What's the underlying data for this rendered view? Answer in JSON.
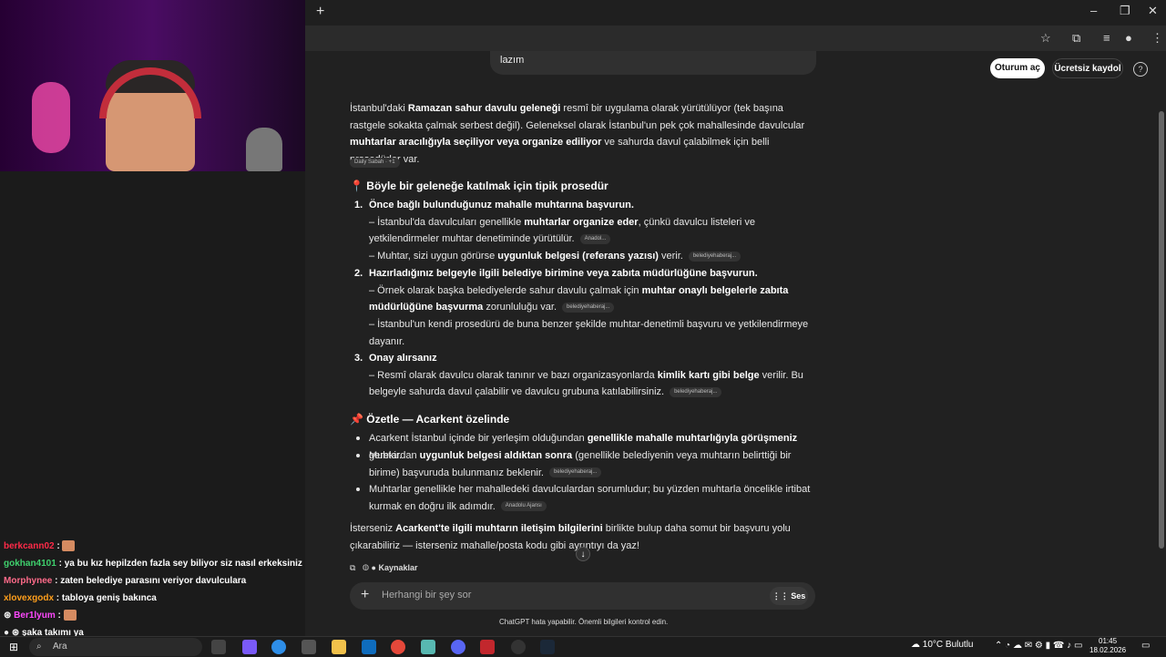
{
  "browser": {
    "new_tab": "+",
    "window_controls": [
      "–",
      "❐",
      "✕"
    ],
    "toolbar_icons": [
      "star-icon",
      "extension-icon",
      "media-icon",
      "profile-icon",
      "menu-icon"
    ]
  },
  "header": {
    "bubble_text": "lazım",
    "login": "Oturum aç",
    "signup": "Ücretsiz kaydol",
    "help": "?"
  },
  "intro": {
    "p1": "İstanbul'daki ",
    "b1": "Ramazan sahur davulu geleneği",
    "p2": " resmî bir uygulama olarak yürütülüyor (tek başına rastgele sokakta çalmak serbest değil). Geleneksel olarak İstanbul'un pek çok mahallesinde davulcular ",
    "b2": "muhtarlar aracılığıyla seçiliyor veya organize ediliyor",
    "p3": " ve sahurda davul çalabilmek için belli prosedürler var.",
    "source": "Daily Sabah · +1"
  },
  "section1": {
    "title": "📍 Böyle bir geleneğe katılmak için tipik prosedür",
    "steps": [
      {
        "num": "1.",
        "title": "Önce bağlı bulunduğunuz mahalle muhtarına başvurun.",
        "l1a": "– İstanbul'da davulcuları genellikle ",
        "l1b": "muhtarlar organize eder",
        "l1c": ", çünkü davulcu listeleri ve yetkilendirmeler muhtar denetiminde yürütülür.",
        "c1": "Anadol...",
        "l2a": "– Muhtar, sizi uygun görürse ",
        "l2b": "uygunluk belgesi (referans yazısı)",
        "l2c": " verir.",
        "c2": "belediyehaberaj..."
      },
      {
        "num": "2.",
        "title": "Hazırladığınız belgeyle ilgili belediye birimine veya zabıta müdürlüğüne başvurun.",
        "l1a": "– Örnek olarak başka belediyelerde sahur davulu çalmak için ",
        "l1b": "muhtar onaylı belgelerle zabıta müdürlüğüne başvurma",
        "l1c": " zorunluluğu var.",
        "c1": "belediyehaberaj...",
        "l2a": "– İstanbul'un kendi prosedürü de buna benzer şekilde muhtar-denetimli başvuru ve yetkilendirmeye dayanır.",
        "l2b": "",
        "l2c": "",
        "c2": ""
      },
      {
        "num": "3.",
        "title": "Onay alırsanız",
        "l1a": "– Resmî olarak davulcu olarak tanınır ve bazı organizasyonlarda ",
        "l1b": "kimlik kartı gibi belge",
        "l1c": " verilir. Bu belgeyle sahurda davul çalabilir ve davulcu grubuna katılabilirsiniz.",
        "c1": "belediyehaberaj...",
        "l2a": "",
        "l2b": "",
        "l2c": "",
        "c2": ""
      }
    ]
  },
  "section2": {
    "title": "📌 Özetle — Acarkent özelinde",
    "b1a": "Acarkent İstanbul içinde bir yerleşim olduğundan ",
    "b1b": "genellikle mahalle muhtarlığıyla görüşmeniz",
    "b1c": " gerekir.",
    "b2a": "Muhtardan ",
    "b2b": "uygunluk belgesi aldıktan sonra",
    "b2c": " (genellikle belediyenin veya muhtarın belirttiği bir birime) başvuruda bulunmanız beklenir.",
    "b2s": "belediyehaberaj...",
    "b3a": "Muhtarlar genellikle her mahalledeki davulculardan sorumludur; bu yüzden muhtarla öncelikle irtibat kurmak en doğru ilk adımdır.",
    "b3s": "Anadolu Ajansı"
  },
  "outro": {
    "p1": "İsterseniz ",
    "b1": "Acarkent'te ilgili muhtarın iletişim bilgilerini",
    "p2": " birlikte bulup daha somut bir başvuru yolu çıkarabiliriz — isterseniz mahalle/posta kodu gibi ayrıntıyı da yaz!"
  },
  "actions": {
    "sources": "Kaynaklar",
    "scroll_down": "↓"
  },
  "composer": {
    "placeholder": "Herhangi bir şey sor",
    "plus": "+",
    "voice": "Ses",
    "disclaimer": "ChatGPT hata yapabilir. Önemli bilgileri kontrol edin."
  },
  "chat": [
    {
      "user": "berkcann02",
      "msg": " :",
      "color": "#ff2a48",
      "emote": true
    },
    {
      "user": "gokhan4101",
      "msg": " : ya bu kız hepilzden fazla sey biliyor siz nasıl erkeksiniz lan: D",
      "color": "#3fd16d",
      "emote": false
    },
    {
      "user": "Morphynee",
      "msg": " : zaten belediye parasını veriyor davulculara",
      "color": "#ff6b8a",
      "emote": false
    },
    {
      "user": "xlovexgodx",
      "msg": " : tabloya geniş bakınca",
      "color": "#ff9f1c",
      "emote": false
    },
    {
      "user": "Ber1lyum",
      "msg": " :",
      "color": "#ff48ff",
      "emote": true
    },
    {
      "user": "",
      "msg": "şaka takımı ya",
      "color": "#ffffff",
      "emote": false
    }
  ],
  "taskbar": {
    "search": "Ara",
    "temp": "10°C",
    "weather": "Bulutlu",
    "time": "01:45",
    "date": "18.02.2026"
  },
  "colors": {
    "bg": "#212121",
    "panel": "#303030",
    "white": "#ffffff"
  }
}
